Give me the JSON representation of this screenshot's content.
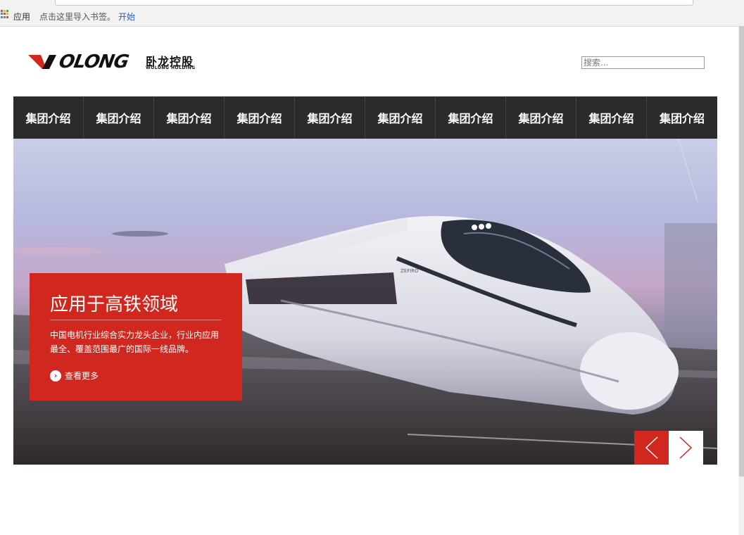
{
  "browser": {
    "bookmarks_apps": "应用",
    "bookmarks_hint": "点击这里导入书签。",
    "bookmarks_start": "开始"
  },
  "header": {
    "logo_word": "OLONG",
    "logo_cn": "卧龙控股",
    "logo_en": "WOLONG HOLDING",
    "search_placeholder": "搜索..."
  },
  "nav": {
    "items": [
      "集团介绍",
      "集团介绍",
      "集团介绍",
      "集团介绍",
      "集团介绍",
      "集团介绍",
      "集团介绍",
      "集团介绍",
      "集团介绍",
      "集团介绍"
    ]
  },
  "banner": {
    "title": "应用于高铁领域",
    "description": "中国电机行业综合实力龙头企业，行业内应用最全、覆盖范围最广的国际一线品牌。",
    "more_label": "查看更多",
    "train_badge": "ZEFIRO",
    "prev_icon": "chevron-left-icon",
    "next_icon": "chevron-right-icon"
  },
  "colors": {
    "brand_red": "#d0271f",
    "nav_bg": "#2b2b2b"
  }
}
